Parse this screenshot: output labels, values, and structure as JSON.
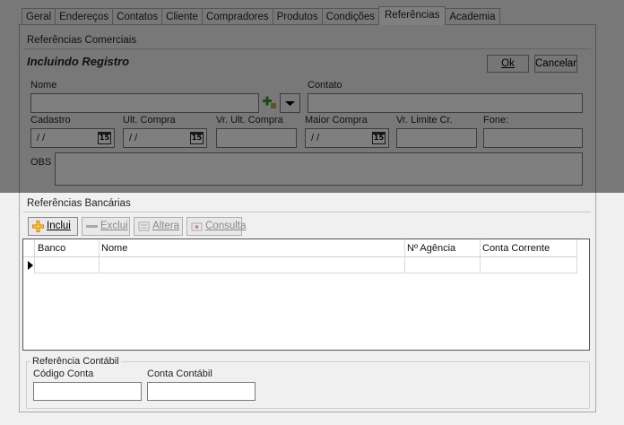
{
  "tabs": [
    "Geral",
    "Endereços",
    "Contatos",
    "Cliente",
    "Compradores",
    "Produtos",
    "Condições",
    "Referências",
    "Academia"
  ],
  "active_tab": "Referências",
  "comerciais": {
    "title": "Referências Comerciais",
    "status": "Incluindo Registro",
    "ok_label": "Ok",
    "cancel_label": "Cancelar",
    "labels": {
      "nome": "Nome",
      "contato": "Contato",
      "cadastro": "Cadastro",
      "ult_compra": "Ult. Compra",
      "vr_ult_compra": "Vr. Ult. Compra",
      "maior_compra": "Maior Compra",
      "vr_limite": "Vr. Limite Cr.",
      "fone": "Fone:",
      "obs": "OBS"
    },
    "date_placeholder": "/ /",
    "calendar_day": "15"
  },
  "bancarias": {
    "title": "Referências Bancárias",
    "toolbar": {
      "inclui": "Inclui",
      "exclui": "Exclui",
      "altera": "Altera",
      "consulta": "Consulta"
    },
    "columns": [
      "Banco",
      "Nome",
      "Nº Agência",
      "Conta Corrente"
    ]
  },
  "contabil": {
    "title": "Referência Contábil",
    "codigo_label": "Código Conta",
    "conta_label": "Conta Contábil"
  },
  "colors": {
    "overlay": "#000000",
    "panel_bg": "#f0f0f0"
  },
  "icons": [
    "dropdown-arrow-icon",
    "add-green-icon",
    "calendar-icon",
    "plus-icon",
    "minus-icon",
    "edit-icon",
    "view-icon"
  ]
}
